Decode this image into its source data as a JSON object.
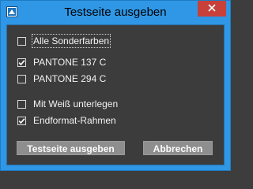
{
  "window": {
    "title": "Testseite ausgeben",
    "app_icon": "app-icon",
    "close_icon": "close-icon"
  },
  "options": [
    {
      "label": "Alle Sonderfarben",
      "checked": false
    },
    {
      "label": "PANTONE 137 C",
      "checked": true
    },
    {
      "label": "PANTONE 294 C",
      "checked": false
    },
    {
      "label": "Mit Weiß unterlegen",
      "checked": false
    },
    {
      "label": "Endformat-Rahmen",
      "checked": true
    }
  ],
  "buttons": {
    "print_label": "Testseite ausgeben",
    "cancel_label": "Abbrechen"
  },
  "colors": {
    "title_bar": "#2f97e6",
    "close": "#c7403a",
    "client": "#3c3c3c",
    "button": "#8e8e8e"
  }
}
